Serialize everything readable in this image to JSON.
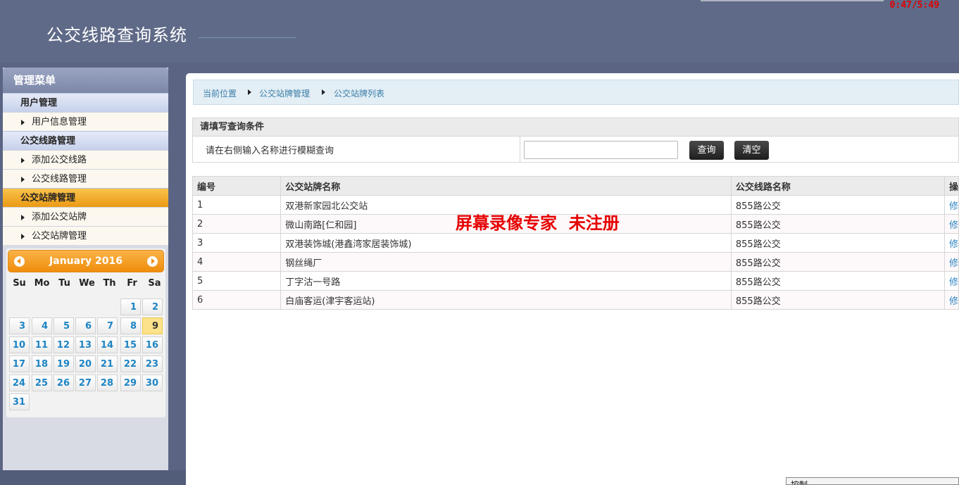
{
  "header": {
    "title": "公交线路查询系统",
    "timer": "0:47/5:49"
  },
  "sidebar": {
    "title": "管理菜单",
    "groups": [
      {
        "label": "用户管理",
        "items": [
          "用户信息管理"
        ]
      },
      {
        "label": "公交线路管理",
        "items": [
          "添加公交线路",
          "公交线路管理"
        ]
      },
      {
        "label": "公交站牌管理",
        "items": [
          "添加公交站牌",
          "公交站牌管理"
        ]
      }
    ]
  },
  "calendar": {
    "month_label": "January 2016",
    "weekdays": [
      "Su",
      "Mo",
      "Tu",
      "We",
      "Th",
      "Fr",
      "Sa"
    ],
    "first_weekday": 5,
    "days_in_month": 31,
    "today": 9
  },
  "breadcrumb": [
    "当前位置",
    "公交站牌管理",
    "公交站牌列表"
  ],
  "query": {
    "heading": "请填写查询条件",
    "label": "请在右侧输入名称进行模糊查询",
    "input_value": "",
    "search_button": "查询",
    "clear_button": "清空"
  },
  "table": {
    "headers": [
      "编号",
      "公交站牌名称",
      "公交线路名称",
      "操"
    ],
    "rows": [
      [
        "1",
        "双港新家园北公交站",
        "855路公交",
        "修"
      ],
      [
        "2",
        "微山南路[仁和园]",
        "855路公交",
        "修"
      ],
      [
        "3",
        "双港装饰城(港鑫湾家居装饰城)",
        "855路公交",
        "修"
      ],
      [
        "4",
        "钢丝绳厂",
        "855路公交",
        "修"
      ],
      [
        "5",
        "丁字沽一号路",
        "855路公交",
        "修"
      ],
      [
        "6",
        "白庙客运(津宇客运站)",
        "855路公交",
        "修"
      ]
    ]
  },
  "watermark": "屏幕录像专家  未注册",
  "control_panel": {
    "label": "控制"
  },
  "colors": {
    "header_bg": "#5f6a88",
    "menu_active": "#eb9a13",
    "calendar_header": "#ef8d0c",
    "link": "#2d86c4",
    "watermark": "#e60000"
  }
}
